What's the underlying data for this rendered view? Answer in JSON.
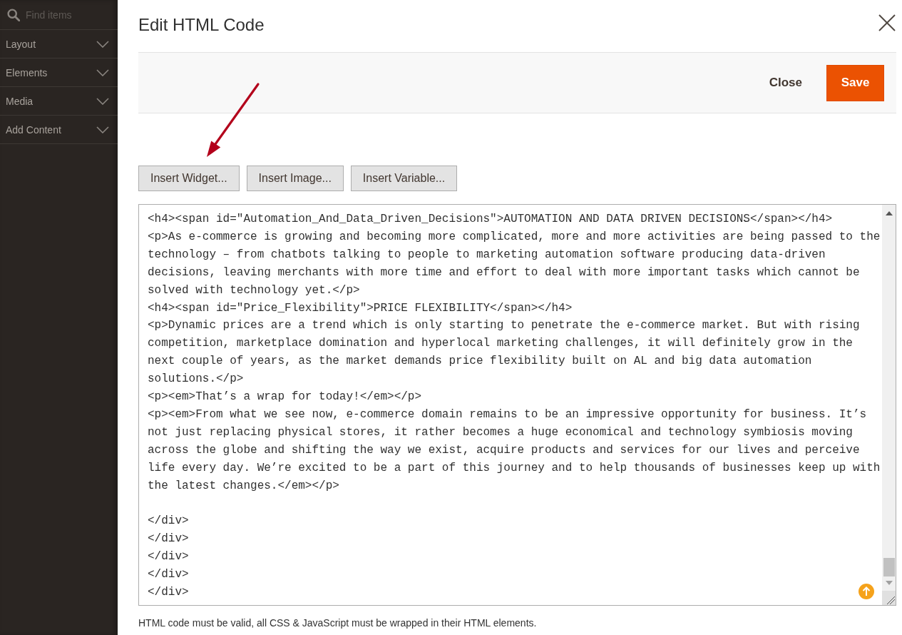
{
  "sidebar": {
    "search": {
      "placeholder": "Find items"
    },
    "items": [
      {
        "label": "Layout",
        "expanded": false
      },
      {
        "label": "Elements",
        "expanded": false
      },
      {
        "label": "Media",
        "expanded": false
      },
      {
        "label": "Add Content",
        "expanded": false
      }
    ]
  },
  "modal": {
    "title": "Edit HTML Code",
    "actions": [
      {
        "label": "Close",
        "kind": "secondary"
      },
      {
        "label": "Save",
        "kind": "primary"
      }
    ],
    "insert_buttons": [
      "Insert Widget...",
      "Insert Image...",
      "Insert Variable..."
    ],
    "editor": {
      "groups": [
        [
          "<h4><span id=\"Automation_And_Data_Driven_Decisions\">AUTOMATION AND DATA DRIVEN DECISIONS</span></h4>",
          "<p>As e-commerce is growing and becoming more complicated, more and more activities are being passed to the",
          "technology – from chatbots talking to people to marketing automation software producing data-driven",
          "decisions, leaving merchants with more time and effort to deal with more important tasks which cannot be",
          "solved with technology yet.</p>",
          "<h4><span id=\"Price_Flexibility\">PRICE FLEXIBILITY</span></h4>",
          "<p>Dynamic prices are a trend which is only starting to penetrate the e-commerce market. But with rising",
          "competition, marketplace domination and hyperlocal marketing challenges, it will definitely grow in the",
          "next couple of years, as the market demands price flexibility built on AL and big data automation",
          "solutions.</p>",
          "<p><em>That’s a wrap for today!</em></p>",
          "<p><em>From what we see now, e-commerce domain remains to be an impressive opportunity for business. It’s",
          "not just replacing physical stores, it rather becomes a huge economical and technology symbiosis moving",
          "across the globe and shifting the way we exist, acquire products and services for our lives and perceive",
          "life every day. We’re excited to be a part of this journey and to help thousands of businesses keep up with",
          "the latest changes.</em></p>"
        ],
        [
          "</div>",
          "</div>",
          "</div>",
          "</div>",
          "</div>"
        ]
      ]
    },
    "note": "HTML code must be valid, all CSS & JavaScript must be wrapped in their HTML elements."
  }
}
